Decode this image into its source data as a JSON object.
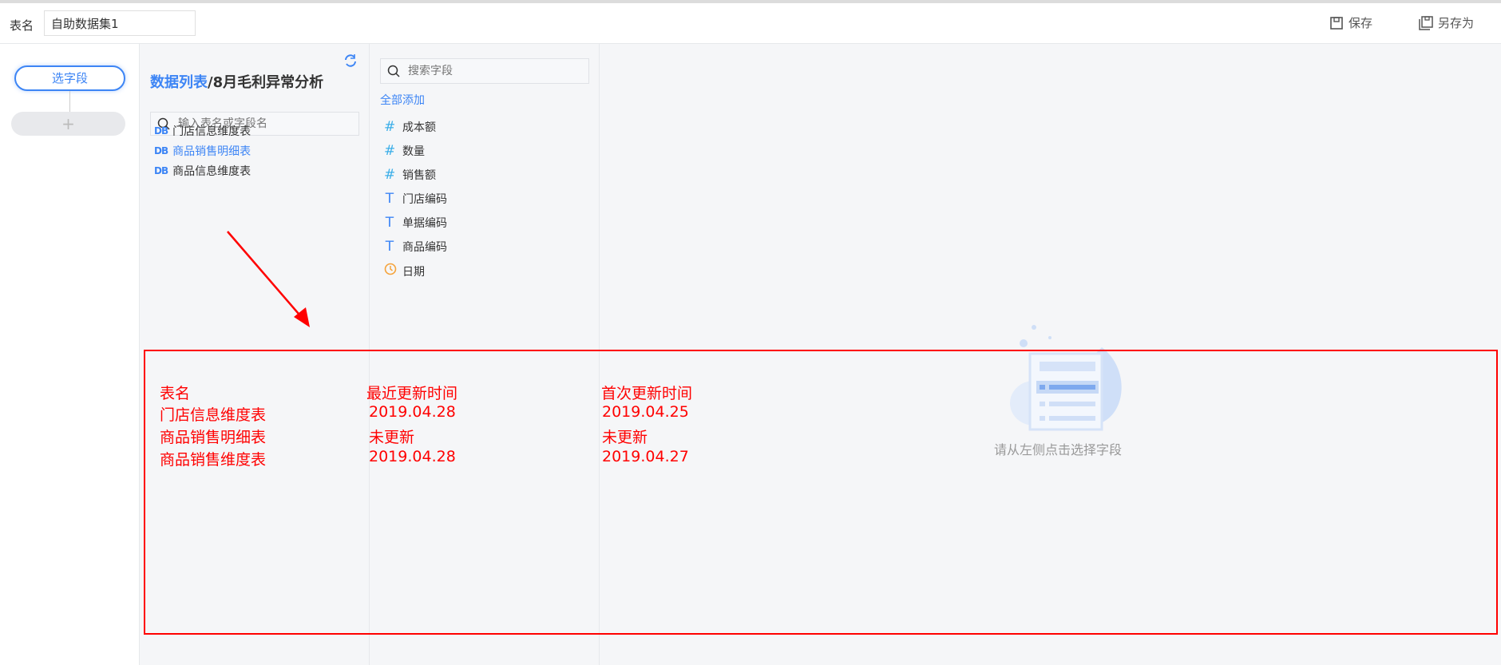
{
  "header": {
    "table_name_label": "表名",
    "table_name_value": "自助数据集1",
    "save_label": "保存",
    "save_as_label": "另存为"
  },
  "steps": {
    "select_fields": "选字段",
    "add": "+"
  },
  "data_list": {
    "title_link": "数据列表",
    "title_rest": "/8月毛利异常分析",
    "search_placeholder": "输入表名或字段名",
    "tables": [
      {
        "icon": "DB",
        "label": "门店信息维度表"
      },
      {
        "icon": "DB",
        "label": "商品销售明细表"
      },
      {
        "icon": "DB",
        "label": "商品信息维度表"
      }
    ]
  },
  "fields": {
    "search_placeholder": "搜索字段",
    "add_all": "全部添加",
    "items": [
      {
        "icon": "#",
        "label": "成本额"
      },
      {
        "icon": "#",
        "label": "数量"
      },
      {
        "icon": "#",
        "label": "销售额"
      },
      {
        "icon": "T",
        "label": "门店编码"
      },
      {
        "icon": "T",
        "label": "单据编码"
      },
      {
        "icon": "T",
        "label": "商品编码"
      },
      {
        "icon": "clock",
        "label": "日期"
      }
    ]
  },
  "main": {
    "empty_text": "请从左侧点击选择字段"
  },
  "annotation": {
    "headers": [
      "表名",
      "最近更新时间",
      "首次更新时间"
    ],
    "rows": [
      [
        "门店信息维度表",
        "2019.04.28",
        "2019.04.25"
      ],
      [
        "商品销售明细表",
        "未更新",
        "未更新"
      ],
      [
        "商品销售维度表",
        "2019.04.28",
        "2019.04.27"
      ]
    ],
    "color": "#ff0000"
  }
}
